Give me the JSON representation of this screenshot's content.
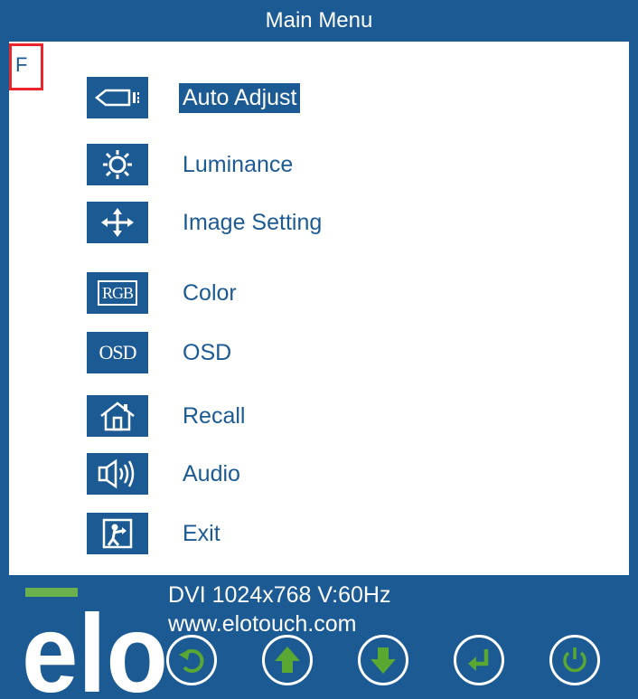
{
  "title": "Main Menu",
  "mode_indicator": "F",
  "menu": {
    "selected_index": 0,
    "items": [
      {
        "label": "Auto Adjust",
        "icon": "auto-adjust-icon"
      },
      {
        "label": "Luminance",
        "icon": "sun-icon"
      },
      {
        "label": "Image Setting",
        "icon": "move-arrows-icon"
      },
      {
        "label": "Color",
        "icon": "rgb-icon",
        "icon_text": "RGB"
      },
      {
        "label": "OSD",
        "icon": "osd-icon",
        "icon_text": "OSD"
      },
      {
        "label": "Recall",
        "icon": "home-icon"
      },
      {
        "label": "Audio",
        "icon": "speaker-icon"
      },
      {
        "label": "Exit",
        "icon": "exit-icon"
      }
    ]
  },
  "footer": {
    "logo_text": "elo",
    "signal_info": "DVI 1024x768 V:60Hz",
    "website": "www.elotouch.com",
    "buttons": [
      {
        "name": "back-icon"
      },
      {
        "name": "up-arrow-icon"
      },
      {
        "name": "down-arrow-icon"
      },
      {
        "name": "enter-icon"
      },
      {
        "name": "power-icon"
      }
    ]
  },
  "colors": {
    "brand_blue": "#1c5a94",
    "logo_green": "#6ab04c",
    "button_green": "#5aa832",
    "highlight_red": "#e8262c"
  }
}
